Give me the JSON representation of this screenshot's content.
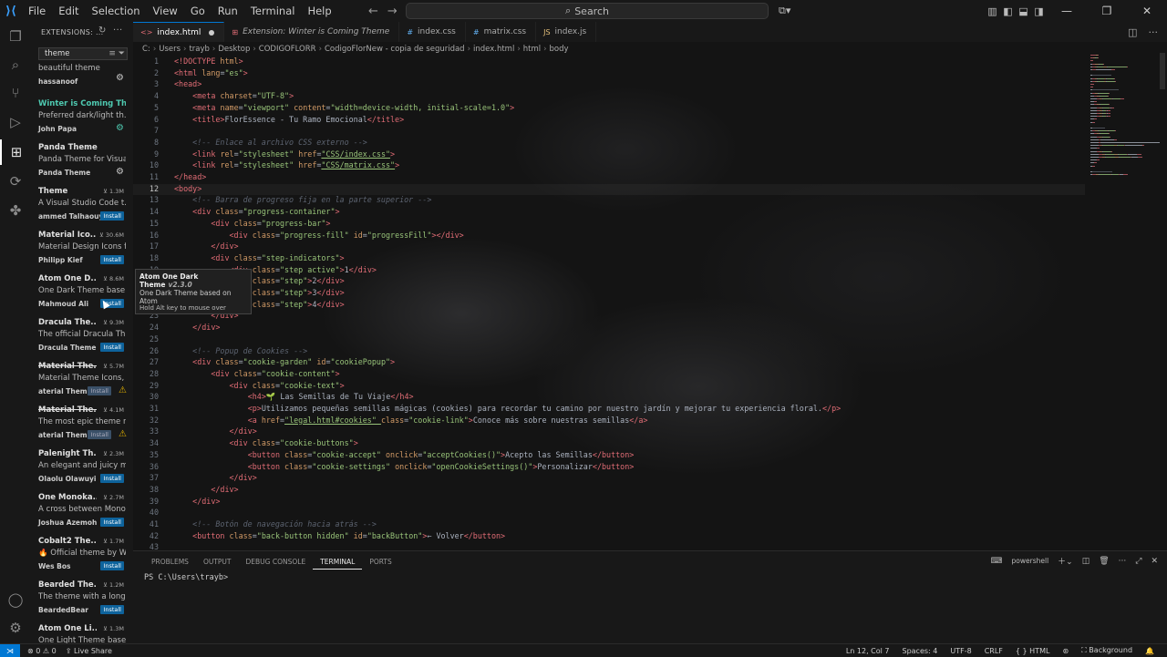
{
  "titlebar": {
    "menu": [
      "File",
      "Edit",
      "Selection",
      "View",
      "Go",
      "Run",
      "Terminal",
      "Help"
    ],
    "search_label": "Search"
  },
  "sidebar": {
    "title": "EXTENSIONS: ...",
    "search_value": "theme",
    "extensions": [
      {
        "name": "",
        "desc": "beautiful theme",
        "publisher": "hassanoof",
        "count": "",
        "action": "gear"
      },
      {
        "name": "Winter is Coming Th...",
        "desc": "Preferred dark/light th...",
        "publisher": "John Papa",
        "count": "",
        "action": "gear-green",
        "selected": true
      },
      {
        "name": "Panda Theme",
        "desc": "Panda Theme for Visua...",
        "publisher": "Panda Theme",
        "count": "",
        "action": "gear"
      },
      {
        "name": "Theme",
        "desc": "A Visual Studio Code t...",
        "publisher": "ammed Talhaouy",
        "count": "1.3M",
        "action": "Install"
      },
      {
        "name": "Material Ico...",
        "desc": "Material Design Icons f...",
        "publisher": "Philipp Kief",
        "count": "30.6M",
        "action": "Install"
      },
      {
        "name": "Atom One D...",
        "desc": "One Dark Theme base...",
        "publisher": "Mahmoud Ali",
        "count": "8.6M",
        "action": "Install"
      },
      {
        "name": "Dracula The...",
        "desc": "The official Dracula Th...",
        "publisher": "Dracula Theme",
        "count": "9.3M",
        "action": "Install"
      },
      {
        "name": "Material The...",
        "desc": "Material Theme Icons, ...",
        "publisher": "aterial Theme",
        "count": "5.7M",
        "action": "Install-dim",
        "strike": true
      },
      {
        "name": "Material The...",
        "desc": "The most epic theme n...",
        "publisher": "aterial Theme",
        "count": "4.1M",
        "action": "Install-dim",
        "strike": true
      },
      {
        "name": "Palenight Th...",
        "desc": "An elegant and juicy m...",
        "publisher": "Olaolu Olawuyi",
        "count": "2.3M",
        "action": "Install"
      },
      {
        "name": "One Monoka...",
        "desc": "A cross between Mono...",
        "publisher": "Joshua Azemoh",
        "count": "2.7M",
        "action": "Install"
      },
      {
        "name": "Cobalt2 The...",
        "desc": "🔥 Official theme by W...",
        "publisher": "Wes Bos",
        "count": "1.7M",
        "action": "Install"
      },
      {
        "name": "Bearded The...",
        "desc": "The theme with a long ...",
        "publisher": "BeardedBear",
        "count": "1.2M",
        "action": "Install"
      },
      {
        "name": "Atom One Li...",
        "desc": "One Light Theme base...",
        "publisher": "",
        "count": "1.3M",
        "action": ""
      }
    ]
  },
  "tabs": [
    {
      "label": "index.html",
      "icon": "<>",
      "active": true,
      "modified": true
    },
    {
      "label": "Extension: Winter is Coming Theme",
      "icon": "⊞",
      "italic": true
    },
    {
      "label": "index.css",
      "icon": "#"
    },
    {
      "label": "matrix.css",
      "icon": "#"
    },
    {
      "label": "index.js",
      "icon": "JS"
    }
  ],
  "breadcrumb": [
    "C:",
    "Users",
    "trayb",
    "Desktop",
    "CODIGOFLORR",
    "CodigoFlorNew - copia de seguridad",
    "index.html",
    "html",
    "body"
  ],
  "tooltip": {
    "title": "Atom One Dark Theme",
    "version": "v2.3.0",
    "desc": "One Dark Theme based on Atom",
    "hint": "Hold Alt key to mouse over"
  },
  "panel": {
    "tabs": [
      "PROBLEMS",
      "OUTPUT",
      "DEBUG CONSOLE",
      "TERMINAL",
      "PORTS"
    ],
    "active_tab": "TERMINAL",
    "terminal_name": "powershell",
    "prompt": "PS C:\\Users\\trayb>"
  },
  "status": {
    "errors": "0",
    "warnings": "0",
    "live_share": "Live Share",
    "position": "Ln 12, Col 7",
    "spaces": "Spaces: 4",
    "encoding": "UTF-8",
    "eol": "CRLF",
    "language": "HTML",
    "extra": "Background"
  },
  "editor": {
    "current_line": 12,
    "lines": [
      [
        [
          "tg",
          "<!DOCTYPE "
        ],
        [
          "at",
          "html"
        ],
        [
          "tg",
          ">"
        ]
      ],
      [
        [
          "tg",
          "<html "
        ],
        [
          "at",
          "lang"
        ],
        [
          "tx",
          "="
        ],
        [
          "st",
          "\"es\""
        ],
        [
          "tg",
          ">"
        ]
      ],
      [
        [
          "tg",
          "<head>"
        ]
      ],
      [
        [
          "tx",
          "    "
        ],
        [
          "tg",
          "<meta "
        ],
        [
          "at",
          "charset"
        ],
        [
          "tx",
          "="
        ],
        [
          "st",
          "\"UTF-8\""
        ],
        [
          "tg",
          ">"
        ]
      ],
      [
        [
          "tx",
          "    "
        ],
        [
          "tg",
          "<meta "
        ],
        [
          "at",
          "name"
        ],
        [
          "tx",
          "="
        ],
        [
          "st",
          "\"viewport\" "
        ],
        [
          "at",
          "content"
        ],
        [
          "tx",
          "="
        ],
        [
          "st",
          "\"width=device-width, initial-scale=1.0\""
        ],
        [
          "tg",
          ">"
        ]
      ],
      [
        [
          "tx",
          "    "
        ],
        [
          "tg",
          "<title>"
        ],
        [
          "tx",
          "FlorEssence - Tu Ramo Emocional"
        ],
        [
          "tg",
          "</title>"
        ]
      ],
      [],
      [
        [
          "tx",
          "    "
        ],
        [
          "cm",
          "<!-- Enlace al archivo CSS externo -->"
        ]
      ],
      [
        [
          "tx",
          "    "
        ],
        [
          "tg",
          "<link "
        ],
        [
          "at",
          "rel"
        ],
        [
          "tx",
          "="
        ],
        [
          "st",
          "\"stylesheet\" "
        ],
        [
          "at",
          "href"
        ],
        [
          "tx",
          "="
        ],
        [
          "st",
          "\"CSS/index.css\""
        ],
        [
          "tg",
          ">"
        ]
      ],
      [
        [
          "tx",
          "    "
        ],
        [
          "tg",
          "<link "
        ],
        [
          "at",
          "rel"
        ],
        [
          "tx",
          "="
        ],
        [
          "st",
          "\"stylesheet\" "
        ],
        [
          "at",
          "href"
        ],
        [
          "tx",
          "="
        ],
        [
          "st",
          "\"CSS/matrix.css\""
        ],
        [
          "tg",
          ">"
        ]
      ],
      [
        [
          "tg",
          "</head>"
        ]
      ],
      [
        [
          "tg",
          "<body>"
        ]
      ],
      [
        [
          "tx",
          "    "
        ],
        [
          "cm",
          "<!-- Barra de progreso fija en la parte superior -->"
        ]
      ],
      [
        [
          "tx",
          "    "
        ],
        [
          "tg",
          "<div "
        ],
        [
          "at",
          "class"
        ],
        [
          "tx",
          "="
        ],
        [
          "st",
          "\"progress-container\""
        ],
        [
          "tg",
          ">"
        ]
      ],
      [
        [
          "tx",
          "        "
        ],
        [
          "tg",
          "<div "
        ],
        [
          "at",
          "class"
        ],
        [
          "tx",
          "="
        ],
        [
          "st",
          "\"progress-bar\""
        ],
        [
          "tg",
          ">"
        ]
      ],
      [
        [
          "tx",
          "            "
        ],
        [
          "tg",
          "<div "
        ],
        [
          "at",
          "class"
        ],
        [
          "tx",
          "="
        ],
        [
          "st",
          "\"progress-fill\" "
        ],
        [
          "at",
          "id"
        ],
        [
          "tx",
          "="
        ],
        [
          "st",
          "\"progressFill\""
        ],
        [
          "tg",
          "></div>"
        ]
      ],
      [
        [
          "tx",
          "        "
        ],
        [
          "tg",
          "</div>"
        ]
      ],
      [
        [
          "tx",
          "        "
        ],
        [
          "tg",
          "<div "
        ],
        [
          "at",
          "class"
        ],
        [
          "tx",
          "="
        ],
        [
          "st",
          "\"step-indicators\""
        ],
        [
          "tg",
          ">"
        ]
      ],
      [
        [
          "tx",
          "            "
        ],
        [
          "tg",
          "<div "
        ],
        [
          "at",
          "class"
        ],
        [
          "tx",
          "="
        ],
        [
          "st",
          "\"step active\""
        ],
        [
          "tg",
          ">"
        ],
        [
          "tx",
          "1"
        ],
        [
          "tg",
          "</div>"
        ]
      ],
      [
        [
          "tx",
          "            "
        ],
        [
          "tg",
          "<div "
        ],
        [
          "at",
          "class"
        ],
        [
          "tx",
          "="
        ],
        [
          "st",
          "\"step\""
        ],
        [
          "tg",
          ">"
        ],
        [
          "tx",
          "2"
        ],
        [
          "tg",
          "</div>"
        ]
      ],
      [
        [
          "tx",
          "            "
        ],
        [
          "tg",
          "<div "
        ],
        [
          "at",
          "class"
        ],
        [
          "tx",
          "="
        ],
        [
          "st",
          "\"step\""
        ],
        [
          "tg",
          ">"
        ],
        [
          "tx",
          "3"
        ],
        [
          "tg",
          "</div>"
        ]
      ],
      [
        [
          "tx",
          "            "
        ],
        [
          "tg",
          "<div "
        ],
        [
          "at",
          "class"
        ],
        [
          "tx",
          "="
        ],
        [
          "st",
          "\"step\""
        ],
        [
          "tg",
          ">"
        ],
        [
          "tx",
          "4"
        ],
        [
          "tg",
          "</div>"
        ]
      ],
      [
        [
          "tx",
          "        "
        ],
        [
          "tg",
          "</div>"
        ]
      ],
      [
        [
          "tx",
          "    "
        ],
        [
          "tg",
          "</div>"
        ]
      ],
      [],
      [
        [
          "tx",
          "    "
        ],
        [
          "cm",
          "<!-- Popup de Cookies -->"
        ]
      ],
      [
        [
          "tx",
          "    "
        ],
        [
          "tg",
          "<div "
        ],
        [
          "at",
          "class"
        ],
        [
          "tx",
          "="
        ],
        [
          "st",
          "\"cookie-garden\" "
        ],
        [
          "at",
          "id"
        ],
        [
          "tx",
          "="
        ],
        [
          "st",
          "\"cookiePopup\""
        ],
        [
          "tg",
          ">"
        ]
      ],
      [
        [
          "tx",
          "        "
        ],
        [
          "tg",
          "<div "
        ],
        [
          "at",
          "class"
        ],
        [
          "tx",
          "="
        ],
        [
          "st",
          "\"cookie-content\""
        ],
        [
          "tg",
          ">"
        ]
      ],
      [
        [
          "tx",
          "            "
        ],
        [
          "tg",
          "<div "
        ],
        [
          "at",
          "class"
        ],
        [
          "tx",
          "="
        ],
        [
          "st",
          "\"cookie-text\""
        ],
        [
          "tg",
          ">"
        ]
      ],
      [
        [
          "tx",
          "                "
        ],
        [
          "tg",
          "<h4>"
        ],
        [
          "tx",
          "🌱 Las Semillas de Tu Viaje"
        ],
        [
          "tg",
          "</h4>"
        ]
      ],
      [
        [
          "tx",
          "                "
        ],
        [
          "tg",
          "<p>"
        ],
        [
          "tx",
          "Utilizamos pequeñas semillas mágicas (cookies) para recordar tu camino por nuestro jardín y mejorar tu experiencia floral."
        ],
        [
          "tg",
          "</p>"
        ]
      ],
      [
        [
          "tx",
          "                "
        ],
        [
          "tg",
          "<a "
        ],
        [
          "at",
          "href"
        ],
        [
          "tx",
          "="
        ],
        [
          "st",
          "\"legal.html#cookies\" "
        ],
        [
          "at",
          "class"
        ],
        [
          "tx",
          "="
        ],
        [
          "st",
          "\"cookie-link\""
        ],
        [
          "tg",
          ">"
        ],
        [
          "tx",
          "Conoce más sobre nuestras semillas"
        ],
        [
          "tg",
          "</a>"
        ]
      ],
      [
        [
          "tx",
          "            "
        ],
        [
          "tg",
          "</div>"
        ]
      ],
      [
        [
          "tx",
          "            "
        ],
        [
          "tg",
          "<div "
        ],
        [
          "at",
          "class"
        ],
        [
          "tx",
          "="
        ],
        [
          "st",
          "\"cookie-buttons\""
        ],
        [
          "tg",
          ">"
        ]
      ],
      [
        [
          "tx",
          "                "
        ],
        [
          "tg",
          "<button "
        ],
        [
          "at",
          "class"
        ],
        [
          "tx",
          "="
        ],
        [
          "st",
          "\"cookie-accept\" "
        ],
        [
          "at",
          "onclick"
        ],
        [
          "tx",
          "="
        ],
        [
          "st",
          "\"acceptCookies()\""
        ],
        [
          "tg",
          ">"
        ],
        [
          "tx",
          "Acepto las Semillas"
        ],
        [
          "tg",
          "</button>"
        ]
      ],
      [
        [
          "tx",
          "                "
        ],
        [
          "tg",
          "<button "
        ],
        [
          "at",
          "class"
        ],
        [
          "tx",
          "="
        ],
        [
          "st",
          "\"cookie-settings\" "
        ],
        [
          "at",
          "onclick"
        ],
        [
          "tx",
          "="
        ],
        [
          "st",
          "\"openCookieSettings()\""
        ],
        [
          "tg",
          ">"
        ],
        [
          "tx",
          "Personalizar"
        ],
        [
          "tg",
          "</button>"
        ]
      ],
      [
        [
          "tx",
          "            "
        ],
        [
          "tg",
          "</div>"
        ]
      ],
      [
        [
          "tx",
          "        "
        ],
        [
          "tg",
          "</div>"
        ]
      ],
      [
        [
          "tx",
          "    "
        ],
        [
          "tg",
          "</div>"
        ]
      ],
      [],
      [
        [
          "tx",
          "    "
        ],
        [
          "cm",
          "<!-- Botón de navegación hacia atrás -->"
        ]
      ],
      [
        [
          "tx",
          "    "
        ],
        [
          "tg",
          "<button "
        ],
        [
          "at",
          "class"
        ],
        [
          "tx",
          "="
        ],
        [
          "st",
          "\"back-button hidden\" "
        ],
        [
          "at",
          "id"
        ],
        [
          "tx",
          "="
        ],
        [
          "st",
          "\"backButton\""
        ],
        [
          "tg",
          ">"
        ],
        [
          "tx",
          "← Volver"
        ],
        [
          "tg",
          "</button>"
        ]
      ],
      []
    ]
  }
}
